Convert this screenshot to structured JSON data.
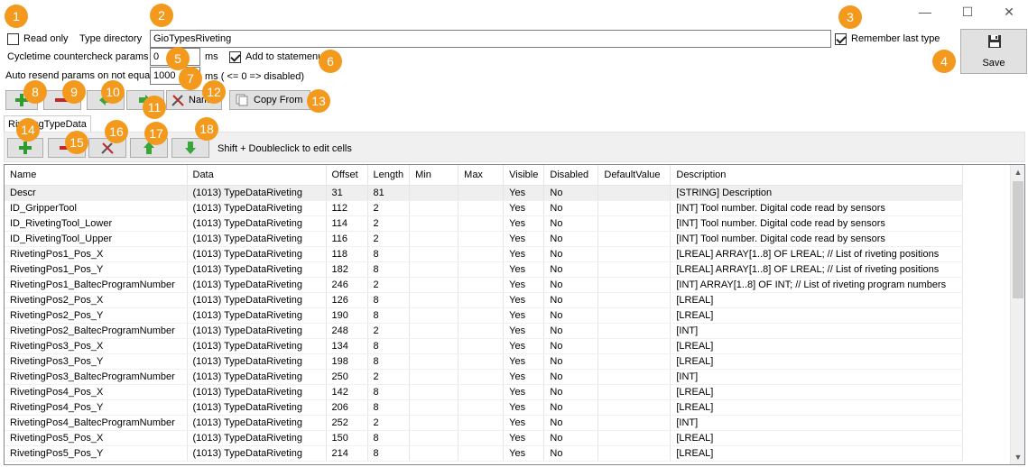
{
  "window": {
    "minimize": "—",
    "maximize": "☐",
    "close": "✕"
  },
  "badges": [
    "1",
    "2",
    "3",
    "4",
    "5",
    "6",
    "7",
    "8",
    "9",
    "10",
    "11",
    "12",
    "13",
    "14",
    "15",
    "16",
    "17",
    "18"
  ],
  "form": {
    "read_only_label": "Read only",
    "type_directory_label": "Type directory",
    "type_directory_value": "GioTypesRiveting",
    "remember_last_type_label": "Remember last type",
    "save_label": "Save",
    "cycletime_label": "Cycletime countercheck params",
    "cycletime_value": "0",
    "cycletime_unit": "ms",
    "add_to_statemenu_label": "Add to statemenu",
    "auto_resend_label": "Auto resend params on not equal",
    "auto_resend_value": "1000",
    "auto_resend_hint": "ms ( <= 0 => disabled)"
  },
  "toolbar": {
    "name_label": "Name",
    "copy_from_label": "Copy From"
  },
  "tab": {
    "label": "RivetingTypeData"
  },
  "subtoolbar": {
    "hint": "Shift + Doubleclick to edit cells"
  },
  "colors": {
    "badge": "#f39a1e",
    "green_plus": "#2e9d2e",
    "red_minus": "#c0282b",
    "selected_row": "#efefef"
  },
  "grid": {
    "columns": [
      "Name",
      "Data",
      "Offset",
      "Length",
      "Min",
      "Max",
      "Visible",
      "Disabled",
      "DefaultValue",
      "Description"
    ],
    "rows": [
      [
        "Descr",
        "(1013) TypeDataRiveting",
        "31",
        "81",
        "",
        "",
        "Yes",
        "No",
        "",
        "[STRING] Description"
      ],
      [
        "ID_GripperTool",
        "(1013) TypeDataRiveting",
        "112",
        "2",
        "",
        "",
        "Yes",
        "No",
        "",
        "[INT] Tool number. Digital code read by sensors"
      ],
      [
        "ID_RivetingTool_Lower",
        "(1013) TypeDataRiveting",
        "114",
        "2",
        "",
        "",
        "Yes",
        "No",
        "",
        "[INT] Tool number. Digital code read by sensors"
      ],
      [
        "ID_RivetingTool_Upper",
        "(1013) TypeDataRiveting",
        "116",
        "2",
        "",
        "",
        "Yes",
        "No",
        "",
        "[INT] Tool number. Digital code read by sensors"
      ],
      [
        "RivetingPos1_Pos_X",
        "(1013) TypeDataRiveting",
        "118",
        "8",
        "",
        "",
        "Yes",
        "No",
        "",
        "[LREAL]     ARRAY[1..8] OF LREAL; // List of riveting positions"
      ],
      [
        "RivetingPos1_Pos_Y",
        "(1013) TypeDataRiveting",
        "182",
        "8",
        "",
        "",
        "Yes",
        "No",
        "",
        "[LREAL]     ARRAY[1..8] OF LREAL; // List of riveting positions"
      ],
      [
        "RivetingPos1_BaltecProgramNumber",
        "(1013) TypeDataRiveting",
        "246",
        "2",
        "",
        "",
        "Yes",
        "No",
        "",
        "[INT] ARRAY[1..8] OF INT; // List of riveting program numbers"
      ],
      [
        "RivetingPos2_Pos_X",
        "(1013) TypeDataRiveting",
        "126",
        "8",
        "",
        "",
        "Yes",
        "No",
        "",
        "[LREAL]"
      ],
      [
        "RivetingPos2_Pos_Y",
        "(1013) TypeDataRiveting",
        "190",
        "8",
        "",
        "",
        "Yes",
        "No",
        "",
        "[LREAL]"
      ],
      [
        "RivetingPos2_BaltecProgramNumber",
        "(1013) TypeDataRiveting",
        "248",
        "2",
        "",
        "",
        "Yes",
        "No",
        "",
        "[INT]"
      ],
      [
        "RivetingPos3_Pos_X",
        "(1013) TypeDataRiveting",
        "134",
        "8",
        "",
        "",
        "Yes",
        "No",
        "",
        "[LREAL]"
      ],
      [
        "RivetingPos3_Pos_Y",
        "(1013) TypeDataRiveting",
        "198",
        "8",
        "",
        "",
        "Yes",
        "No",
        "",
        "[LREAL]"
      ],
      [
        "RivetingPos3_BaltecProgramNumber",
        "(1013) TypeDataRiveting",
        "250",
        "2",
        "",
        "",
        "Yes",
        "No",
        "",
        "[INT]"
      ],
      [
        "RivetingPos4_Pos_X",
        "(1013) TypeDataRiveting",
        "142",
        "8",
        "",
        "",
        "Yes",
        "No",
        "",
        "[LREAL]"
      ],
      [
        "RivetingPos4_Pos_Y",
        "(1013) TypeDataRiveting",
        "206",
        "8",
        "",
        "",
        "Yes",
        "No",
        "",
        "[LREAL]"
      ],
      [
        "RivetingPos4_BaltecProgramNumber",
        "(1013) TypeDataRiveting",
        "252",
        "2",
        "",
        "",
        "Yes",
        "No",
        "",
        "[INT]"
      ],
      [
        "RivetingPos5_Pos_X",
        "(1013) TypeDataRiveting",
        "150",
        "8",
        "",
        "",
        "Yes",
        "No",
        "",
        "[LREAL]"
      ],
      [
        "RivetingPos5_Pos_Y",
        "(1013) TypeDataRiveting",
        "214",
        "8",
        "",
        "",
        "Yes",
        "No",
        "",
        "[LREAL]"
      ]
    ]
  }
}
